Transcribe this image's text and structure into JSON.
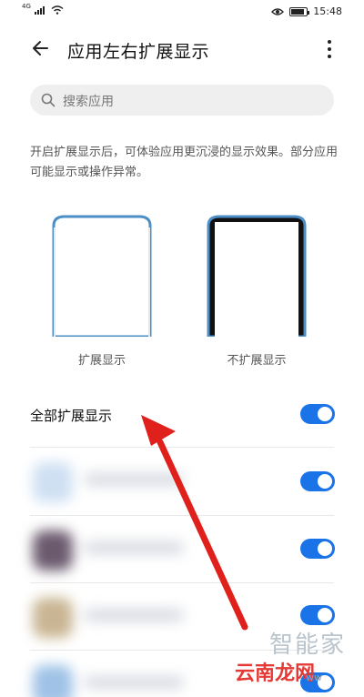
{
  "status_bar": {
    "network": "4G",
    "time": "15:48"
  },
  "header": {
    "title": "应用左右扩展显示"
  },
  "search": {
    "placeholder": "搜索应用"
  },
  "description": "开启扩展显示后，可体验应用更沉浸的显示效果。部分应用可能显示或操作异常。",
  "previews": [
    {
      "label": "扩展显示"
    },
    {
      "label": "不扩展显示"
    }
  ],
  "all_toggle": {
    "label": "全部扩展显示",
    "enabled": true
  },
  "apps": [
    {
      "enabled": true,
      "icon_color": "#cfe0f3"
    },
    {
      "enabled": true,
      "icon_color": "#6b5a6e"
    },
    {
      "enabled": true,
      "icon_color": "#c9b593"
    },
    {
      "enabled": true,
      "icon_color": "#9fc2e6"
    }
  ],
  "watermark": {
    "top": "智能家",
    "main": "云南龙网",
    "sub": "ww"
  },
  "colors": {
    "accent": "#1b73e8",
    "arrow": "#e0201b"
  }
}
